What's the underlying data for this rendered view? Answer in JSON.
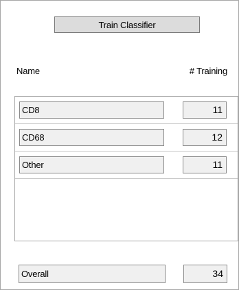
{
  "toolbar": {
    "train_label": "Train Classifier"
  },
  "table": {
    "headers": {
      "name": "Name",
      "training": "# Training"
    },
    "rows": [
      {
        "name": "CD8",
        "count": "11"
      },
      {
        "name": "CD68",
        "count": "12"
      },
      {
        "name": "Other",
        "count": "11"
      }
    ]
  },
  "overall": {
    "label": "Overall",
    "count": "34"
  }
}
